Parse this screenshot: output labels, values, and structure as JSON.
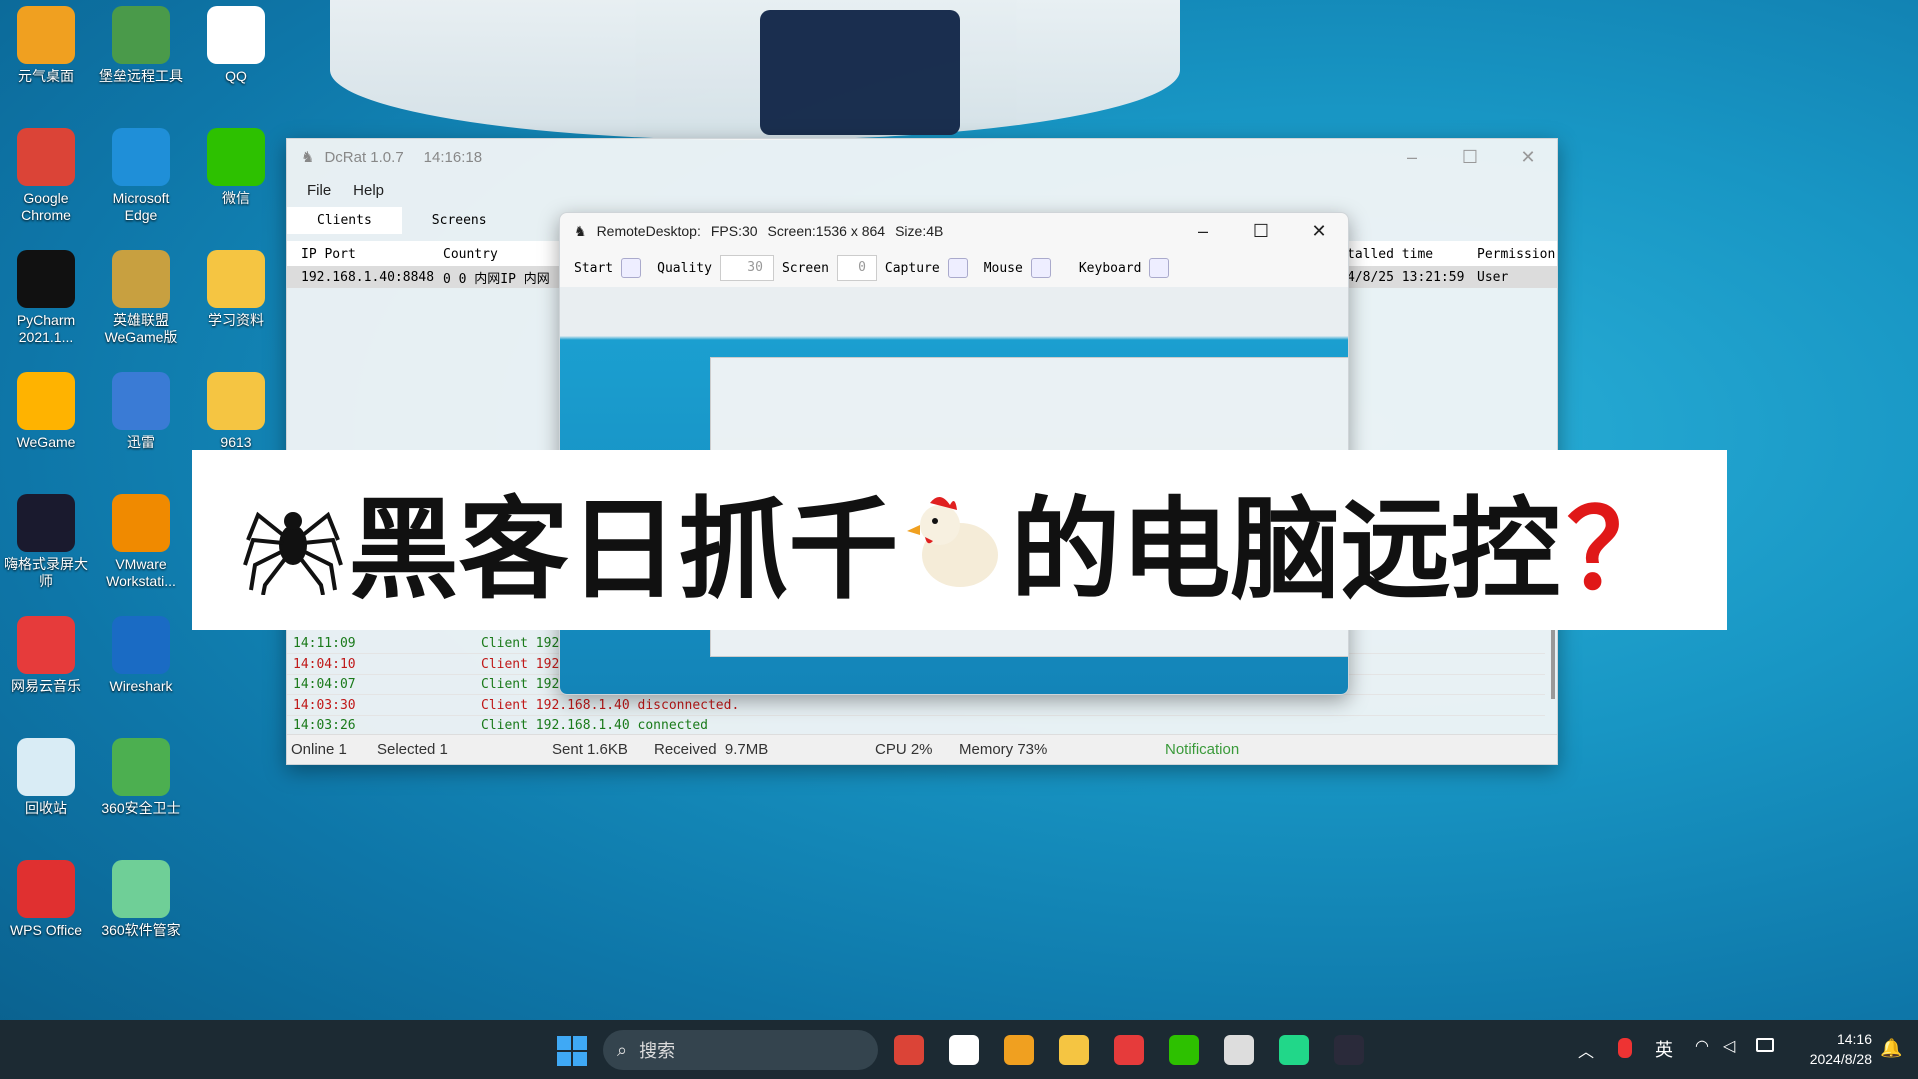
{
  "desktop": {
    "icons": [
      {
        "label": "元气桌面",
        "color": "#f0a020"
      },
      {
        "label": "堡垒远程工具",
        "color": "#4a9a4a"
      },
      {
        "label": "QQ",
        "color": "#ffffff"
      },
      {
        "label": "Google Chrome",
        "color": "#db4437"
      },
      {
        "label": "Microsoft Edge",
        "color": "#1f8fd8"
      },
      {
        "label": "微信",
        "color": "#2dc100"
      },
      {
        "label": "PyCharm 2021.1...",
        "color": "#111111"
      },
      {
        "label": "英雄联盟WeGame版",
        "color": "#c8a040"
      },
      {
        "label": "学习资料",
        "color": "#f5c542"
      },
      {
        "label": "WeGame",
        "color": "#ffb300"
      },
      {
        "label": "迅雷",
        "color": "#3a7bd5"
      },
      {
        "label": "9613",
        "color": "#f5c542"
      },
      {
        "label": "嗨格式录屏大师",
        "color": "#1a1a2e"
      },
      {
        "label": "VMware Workstati...",
        "color": "#f08a00"
      },
      {
        "label": "网易云音乐",
        "color": "#e63b3b"
      },
      {
        "label": "Wireshark",
        "color": "#1a6bc4"
      },
      {
        "label": "回收站",
        "color": "#d9ecf5"
      },
      {
        "label": "360安全卫士",
        "color": "#4caf50"
      },
      {
        "label": "WPS Office",
        "color": "#e03030"
      },
      {
        "label": "360软件管家",
        "color": "#6fcf97"
      }
    ]
  },
  "dcrat": {
    "title": "DcRat 1.0.7",
    "time": "14:16:18",
    "menu": [
      "File",
      "Help"
    ],
    "tabs": [
      "Clients",
      "Screens"
    ],
    "columns": [
      "IP Port",
      "Country",
      "talled time",
      "Permission"
    ],
    "row": {
      "ip": "192.168.1.40:8848",
      "country": "0 0 内网IP 内网",
      "installed": "4/8/25 13:21:59",
      "permission": "User"
    },
    "logs": [
      {
        "time": "14:11:09",
        "msg": "Client 192",
        "color": "#1a7a1a"
      },
      {
        "time": "14:04:10",
        "msg": "Client 192",
        "color": "#c01818"
      },
      {
        "time": "14:04:07",
        "msg": "Client 192",
        "color": "#1a7a1a"
      },
      {
        "time": "14:03:30",
        "msg": "Client 192.168.1.40 disconnected.",
        "color": "#c01818"
      },
      {
        "time": "14:03:26",
        "msg": "Client 192.168.1.40 connected",
        "color": "#1a7a1a"
      }
    ],
    "status": {
      "online": "Online 1",
      "selected": "Selected 1",
      "sent": "Sent 1.6KB",
      "received": "Received  9.7MB",
      "cpu": "CPU 2%",
      "memory": "Memory 73%",
      "notification": "Notification"
    }
  },
  "remote": {
    "title": "RemoteDesktop:",
    "fps": "FPS:30",
    "screen": "Screen:1536 x 864",
    "size": "Size:4B",
    "toolbar": {
      "start": "Start",
      "quality": "Quality",
      "quality_value": "30",
      "screen": "Screen",
      "screen_value": "0",
      "capture": "Capture",
      "mouse": "Mouse",
      "keyboard": "Keyboard"
    }
  },
  "banner": {
    "part1": "黑客日抓千",
    "part2": "的电脑远控",
    "mark": "？"
  },
  "taskbar": {
    "search": "搜索",
    "ime": "英",
    "time": "14:16",
    "date": "2024/8/28",
    "apps": [
      {
        "name": "chrome",
        "color": "#db4437"
      },
      {
        "name": "qq",
        "color": "#ffffff"
      },
      {
        "name": "remote-app",
        "color": "#f0a020"
      },
      {
        "name": "file-explorer",
        "color": "#f5c542"
      },
      {
        "name": "netease-music",
        "color": "#e63b3b"
      },
      {
        "name": "wechat",
        "color": "#2dc100"
      },
      {
        "name": "dcrat",
        "color": "#dddddd"
      },
      {
        "name": "pycharm",
        "color": "#21d789"
      },
      {
        "name": "camera",
        "color": "#2a2a3a"
      }
    ]
  }
}
